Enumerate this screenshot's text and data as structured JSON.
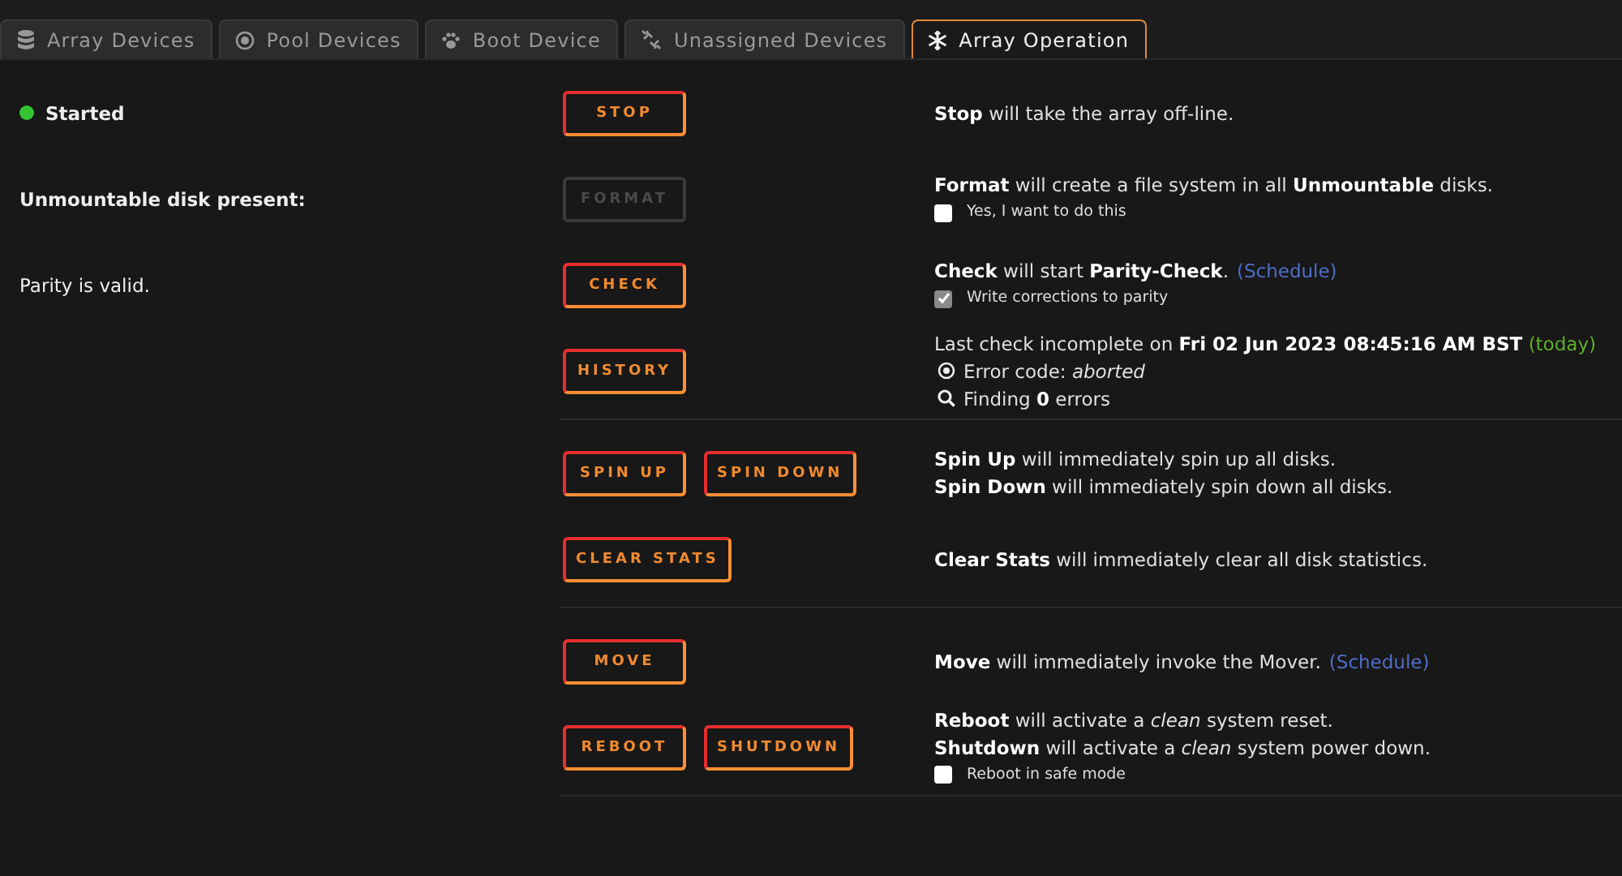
{
  "tabs": [
    {
      "label": "Array Devices",
      "selected": false
    },
    {
      "label": "Pool Devices",
      "selected": false
    },
    {
      "label": "Boot Device",
      "selected": false
    },
    {
      "label": "Unassigned Devices",
      "selected": false
    },
    {
      "label": "Array Operation",
      "selected": true
    }
  ],
  "sections": [
    {
      "rows": [
        {
          "status": {
            "kind": "dot",
            "text": "Started"
          },
          "buttons": [
            {
              "label": "STOP",
              "disabled": false
            }
          ],
          "lines": [
            {
              "kind": "text",
              "text": "**Stop** will take the array off-line."
            }
          ]
        },
        {
          "status": {
            "kind": "bold",
            "text": "Unmountable disk present:"
          },
          "buttons": [
            {
              "label": "FORMAT",
              "disabled": true
            }
          ],
          "lines": [
            {
              "kind": "text",
              "text": "**Format** will create a file system in all **Unmountable** disks."
            },
            {
              "kind": "checkbox",
              "label": "Yes, I want to do this",
              "checked": false
            }
          ]
        },
        {
          "status": {
            "kind": "plain",
            "text": "Parity is valid."
          },
          "buttons": [
            {
              "label": "CHECK",
              "disabled": false
            }
          ],
          "lines": [
            {
              "kind": "text",
              "text": "**Check** will start **Parity-Check**.",
              "link": "(Schedule)"
            },
            {
              "kind": "checkbox",
              "label": "Write corrections to parity",
              "checked": true
            }
          ]
        },
        {
          "buttons": [
            {
              "label": "HISTORY",
              "disabled": false
            }
          ],
          "lines": [
            {
              "kind": "text",
              "text": "Last check incomplete on **Fri 02 Jun 2023 08:45:16 AM BST**",
              "note": "(today)"
            },
            {
              "kind": "target",
              "text": "Error code: *aborted*"
            },
            {
              "kind": "search",
              "text": "Finding **0** errors"
            }
          ]
        }
      ]
    },
    {
      "rows": [
        {
          "buttons": [
            {
              "label": "SPIN UP",
              "disabled": false
            },
            {
              "label": "SPIN DOWN",
              "disabled": false
            }
          ],
          "lines": [
            {
              "kind": "text",
              "text": "**Spin Up** will immediately spin up all disks."
            },
            {
              "kind": "text",
              "text": "**Spin Down** will immediately spin down all disks."
            }
          ]
        },
        {
          "buttons": [
            {
              "label": "CLEAR STATS",
              "disabled": false
            }
          ],
          "lines": [
            {
              "kind": "text",
              "text": "**Clear Stats** will immediately clear all disk statistics."
            }
          ]
        }
      ]
    },
    {
      "rows": [
        {
          "buttons": [
            {
              "label": "MOVE",
              "disabled": false
            }
          ],
          "lines": [
            {
              "kind": "text",
              "text": "**Move** will immediately invoke the Mover.",
              "link": "(Schedule)"
            }
          ]
        },
        {
          "buttons": [
            {
              "label": "REBOOT",
              "disabled": false
            },
            {
              "label": "SHUTDOWN",
              "disabled": false
            }
          ],
          "lines": [
            {
              "kind": "text",
              "text": "**Reboot** will activate a *clean* system reset."
            },
            {
              "kind": "text",
              "text": "**Shutdown** will activate a *clean* system power down."
            },
            {
              "kind": "checkbox",
              "label": "Reboot in safe mode",
              "checked": false
            }
          ]
        }
      ]
    }
  ]
}
